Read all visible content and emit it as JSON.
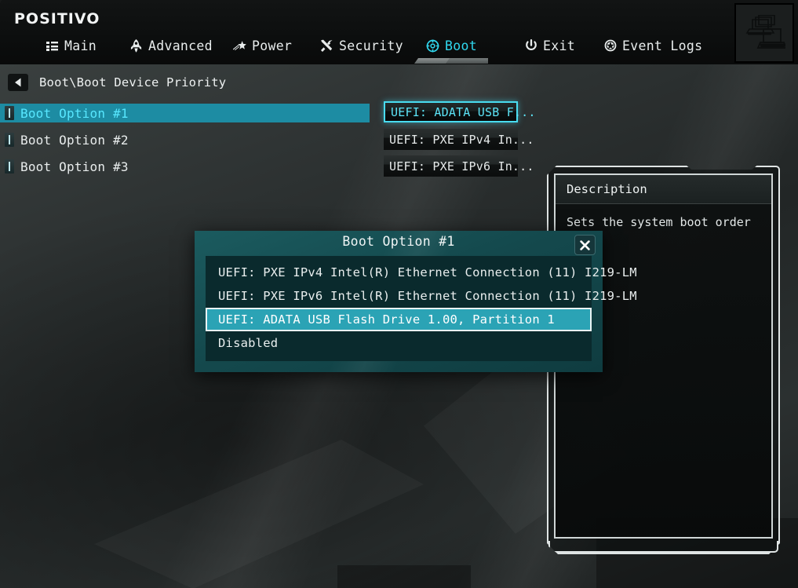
{
  "header": {
    "logo": "POSITIVO",
    "badge_icon": "computers-icon",
    "menu": [
      {
        "label": "Main",
        "icon": "list-icon",
        "active": false
      },
      {
        "label": "Advanced",
        "icon": "rocket-icon",
        "active": false
      },
      {
        "label": "Power",
        "icon": "star-icon",
        "active": false
      },
      {
        "label": "Security",
        "icon": "tools-icon",
        "active": false
      },
      {
        "label": "Boot",
        "icon": "target-icon",
        "active": true
      },
      {
        "label": "Exit",
        "icon": "power-icon",
        "active": false
      },
      {
        "label": "Event Logs",
        "icon": "badge-icon",
        "active": false
      }
    ]
  },
  "breadcrumb": {
    "back_icon": "back-arrow-icon",
    "path": "Boot\\Boot Device Priority"
  },
  "options": [
    {
      "label": "Boot Option #1",
      "value": "UEFI: ADATA USB F...",
      "selected": true
    },
    {
      "label": "Boot Option #2",
      "value": "UEFI: PXE IPv4 In...",
      "selected": false
    },
    {
      "label": "Boot Option #3",
      "value": "UEFI: PXE IPv6 In...",
      "selected": false
    }
  ],
  "description": {
    "title": "Description",
    "text": "Sets the system boot order"
  },
  "dialog": {
    "title": "Boot Option #1",
    "close_icon": "close-icon",
    "items": [
      {
        "label": "UEFI: PXE IPv4 Intel(R) Ethernet Connection (11) I219-LM",
        "selected": false
      },
      {
        "label": "UEFI: PXE IPv6 Intel(R) Ethernet Connection (11) I219-LM",
        "selected": false
      },
      {
        "label": "UEFI: ADATA USB Flash Drive 1.00, Partition 1",
        "selected": true
      },
      {
        "label": "Disabled",
        "selected": false
      }
    ]
  },
  "colors": {
    "accent_cyan": "#30d8ef",
    "row_selected": "#1d8ca3",
    "dialog_selected": "#2ba3b5",
    "dialog_header": "#1b5b5f",
    "dialog_body": "#0a2a2d"
  }
}
